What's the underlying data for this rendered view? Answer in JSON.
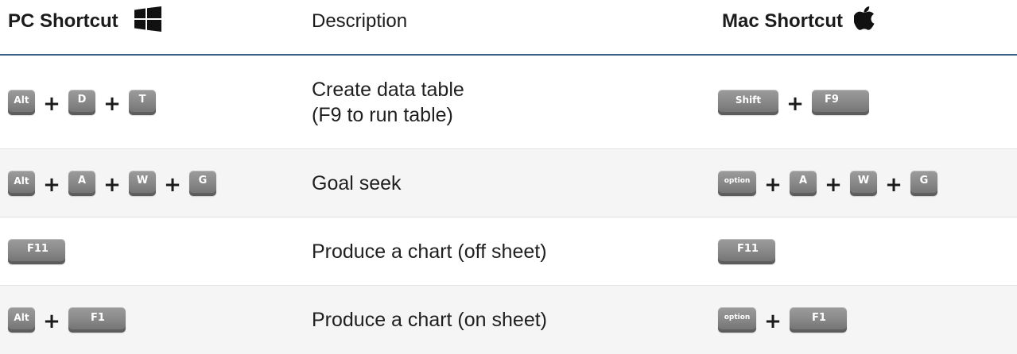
{
  "header": {
    "pc_label": "PC Shortcut",
    "pc_icon": "windows-logo-icon",
    "description_label": "Description",
    "mac_label": "Mac Shortcut",
    "mac_icon": "apple-logo-icon"
  },
  "rows": [
    {
      "pc_keys": [
        "Alt",
        "D",
        "T"
      ],
      "description": "Create data table\n(F9 to run table)",
      "mac_keys": [
        "Shift",
        "F9"
      ]
    },
    {
      "pc_keys": [
        "Alt",
        "A",
        "W",
        "G"
      ],
      "description": "Goal seek",
      "mac_keys": [
        "option",
        "A",
        "W",
        "G"
      ]
    },
    {
      "pc_keys": [
        "F11"
      ],
      "description": "Produce a chart (off sheet)",
      "mac_keys": [
        "F11"
      ]
    },
    {
      "pc_keys": [
        "Alt",
        "F1"
      ],
      "description": "Produce a chart (on sheet)",
      "mac_keys": [
        "option",
        "F1"
      ]
    }
  ],
  "plus_symbol": "+",
  "colors": {
    "header_rule": "#3a5f86",
    "key_face": "#8a8a8a",
    "alt_row": "#f5f5f5"
  }
}
